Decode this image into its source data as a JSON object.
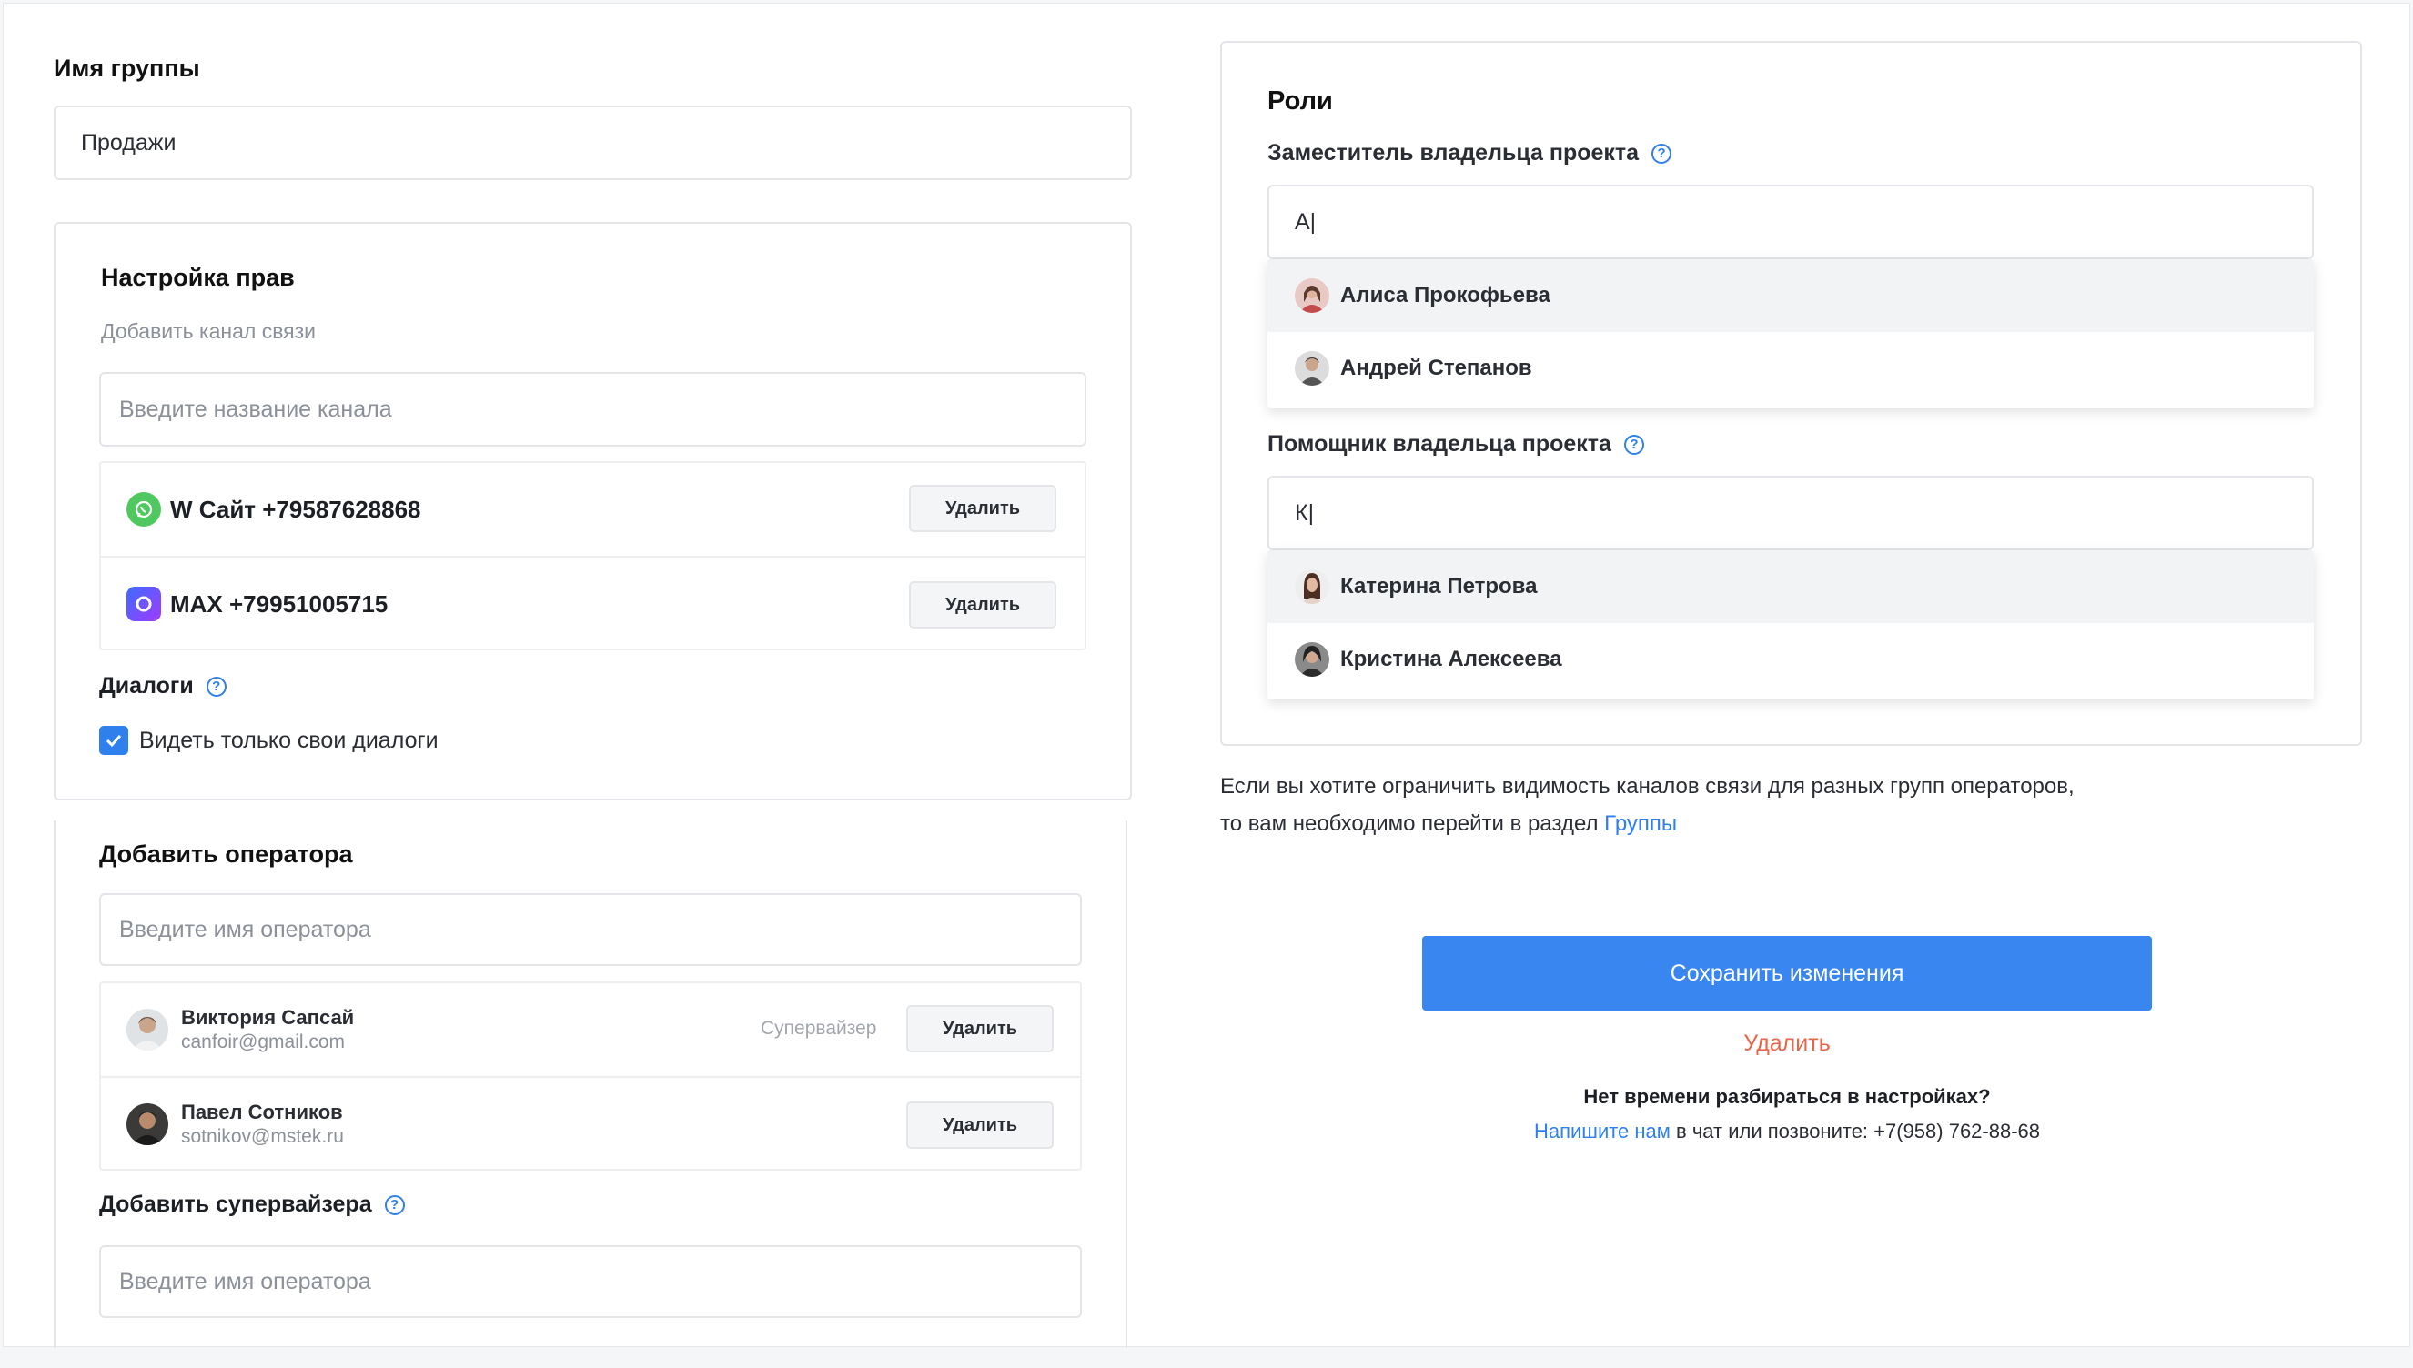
{
  "group": {
    "label": "Имя группы",
    "value": "Продажи"
  },
  "rights": {
    "title": "Настройка прав",
    "subtitle": "Добавить канал связи",
    "channel_placeholder": "Введите название канала",
    "channels": [
      {
        "name": "W Сайт +79587628868",
        "icon": "whatsapp-icon",
        "delete": "Удалить"
      },
      {
        "name": "MAX +79951005715",
        "icon": "max-messenger-icon",
        "delete": "Удалить"
      }
    ],
    "dialogs_label": "Диалоги",
    "dialogs_checkbox": "Видеть только свои диалоги"
  },
  "operators": {
    "title": "Добавить оператора",
    "placeholder": "Введите имя оператора",
    "list": [
      {
        "name": "Виктория Сапсай",
        "email": "canfoir@gmail.com",
        "role": "Супервайзер",
        "delete": "Удалить"
      },
      {
        "name": "Павел Сотников",
        "email": "sotnikov@mstek.ru",
        "role": "",
        "delete": "Удалить"
      }
    ],
    "supervisor_title": "Добавить супервайзера",
    "supervisor_placeholder": "Введите имя оператора"
  },
  "roles": {
    "title": "Роли",
    "deputy_label": "Заместитель владельца проекта",
    "deputy_value": "А|",
    "deputy_options": [
      "Алиса Прокофьева",
      "Андрей Степанов"
    ],
    "assistant_label": "Помощник владельца проекта",
    "assistant_value": "К|",
    "assistant_options": [
      "Катерина Петрова",
      "Кристина Алексеева"
    ]
  },
  "info": {
    "line1": "Если вы хотите ограничить видимость каналов связи для разных групп операторов,",
    "line2": "то вам необходимо перейти в раздел ",
    "link": "Группы"
  },
  "actions": {
    "save": "Сохранить изменения",
    "delete": "Удалить",
    "help_title": "Нет времени разбираться в настройках?",
    "help_link": "Напишите нам",
    "help_rest": " в чат или позвоните: +7(958) 762-88-68"
  },
  "colors": {
    "accent": "#3a86f0",
    "danger": "#e8664a",
    "link": "#2f80ed"
  }
}
